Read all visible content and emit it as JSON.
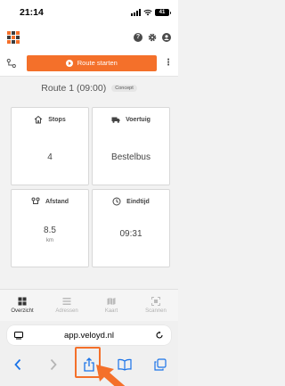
{
  "status_bar": {
    "time": "21:14",
    "battery": "41"
  },
  "header": {
    "logo_colors": [
      "#f4702a",
      "#3c3c3c",
      "#f4702a",
      "#3c3c3c",
      "#f4702a",
      "#3c3c3c",
      "#f4702a",
      "#3c3c3c",
      "#f4702a"
    ],
    "icons": [
      "help-icon",
      "settings-icon",
      "account-icon"
    ]
  },
  "toolbar": {
    "start_label": "Route starten"
  },
  "route": {
    "title": "Route 1 (09:00)",
    "badge": "Concept"
  },
  "cards": {
    "stops": {
      "label": "Stops",
      "value": "4"
    },
    "vehicle": {
      "label": "Voertuig",
      "value": "Bestelbus"
    },
    "distance": {
      "label": "Afstand",
      "value": "8.5",
      "unit": "km"
    },
    "end_time": {
      "label": "Eindtijd",
      "value": "09:31"
    }
  },
  "nav": {
    "items": [
      {
        "label": "Overzicht",
        "icon": "grid-icon",
        "active": true
      },
      {
        "label": "Adressen",
        "icon": "list-icon",
        "active": false
      },
      {
        "label": "Kaart",
        "icon": "map-icon",
        "active": false
      },
      {
        "label": "Scannen",
        "icon": "scan-icon",
        "active": false
      }
    ]
  },
  "browser": {
    "url": "app.veloyd.nl"
  },
  "colors": {
    "accent": "#f4702a",
    "text": "#444444"
  }
}
